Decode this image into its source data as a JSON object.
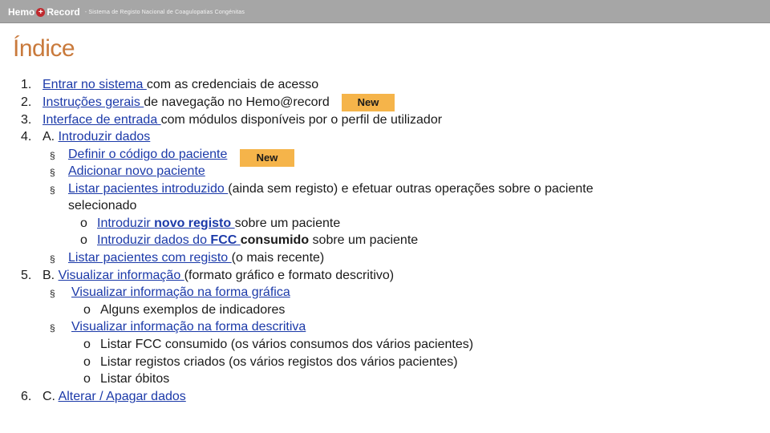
{
  "header": {
    "logo_left": "Hemo",
    "logo_cross": "+",
    "logo_right": "Record",
    "tagline": "- Sistema de Registo Nacional de Coagulopatias Congénitas"
  },
  "page_title": "Índice",
  "badge_label": "New",
  "items": {
    "i1": {
      "num": "1.",
      "link": "Entrar no sistema ",
      "rest": "com as credenciais de acesso"
    },
    "i2": {
      "num": "2.",
      "link": "Instruções gerais ",
      "rest": "de navegação no Hemo@record"
    },
    "i3": {
      "num": "3.",
      "link": "Interface de entrada ",
      "rest": "com módulos disponíveis por o perfil de utilizador"
    },
    "i4": {
      "num": "4.",
      "prefix": "A. ",
      "link": "Introduzir dados"
    },
    "i4a": {
      "bullet": "§",
      "link": "Definir o código do paciente"
    },
    "i4b": {
      "bullet": "§",
      "link": "Adicionar novo paciente"
    },
    "i4c": {
      "bullet": "§",
      "link": "Listar pacientes introduzido ",
      "rest": "(ainda sem registo) e efetuar outras operações sobre o paciente",
      "rest2": "selecionado"
    },
    "i4c1": {
      "bullet": "o",
      "link1": "Introduzir ",
      "link_bold": "novo registo ",
      "rest": "sobre um paciente"
    },
    "i4c2": {
      "bullet": "o",
      "link1": "Introduzir dados do ",
      "link_bold": "FCC ",
      "bold": "consumido",
      "rest": " sobre um paciente"
    },
    "i4d": {
      "bullet": "§",
      "link": "Listar pacientes com registo ",
      "rest": "(o mais recente)"
    },
    "i5": {
      "num": "5.",
      "prefix": "B. ",
      "link": "Visualizar informação ",
      "rest": "(formato gráfico e formato descritivo)"
    },
    "i5a": {
      "bullet": "§",
      "link": "Visualizar informação na forma gráfica"
    },
    "i5a1": {
      "bullet": "o",
      "text": "Alguns exemplos de indicadores"
    },
    "i5b": {
      "bullet": "§",
      "link": "Visualizar informação na forma descritiva"
    },
    "i5b1": {
      "bullet": "o",
      "text": "Listar FCC consumido (os vários consumos dos vários pacientes)"
    },
    "i5b2": {
      "bullet": "o",
      "text": "Listar registos criados (os vários registos dos vários pacientes)"
    },
    "i5b3": {
      "bullet": "o",
      "text": "Listar óbitos"
    },
    "i6": {
      "num": "6.",
      "prefix": "C. ",
      "link": "Alterar / Apagar dados"
    }
  }
}
